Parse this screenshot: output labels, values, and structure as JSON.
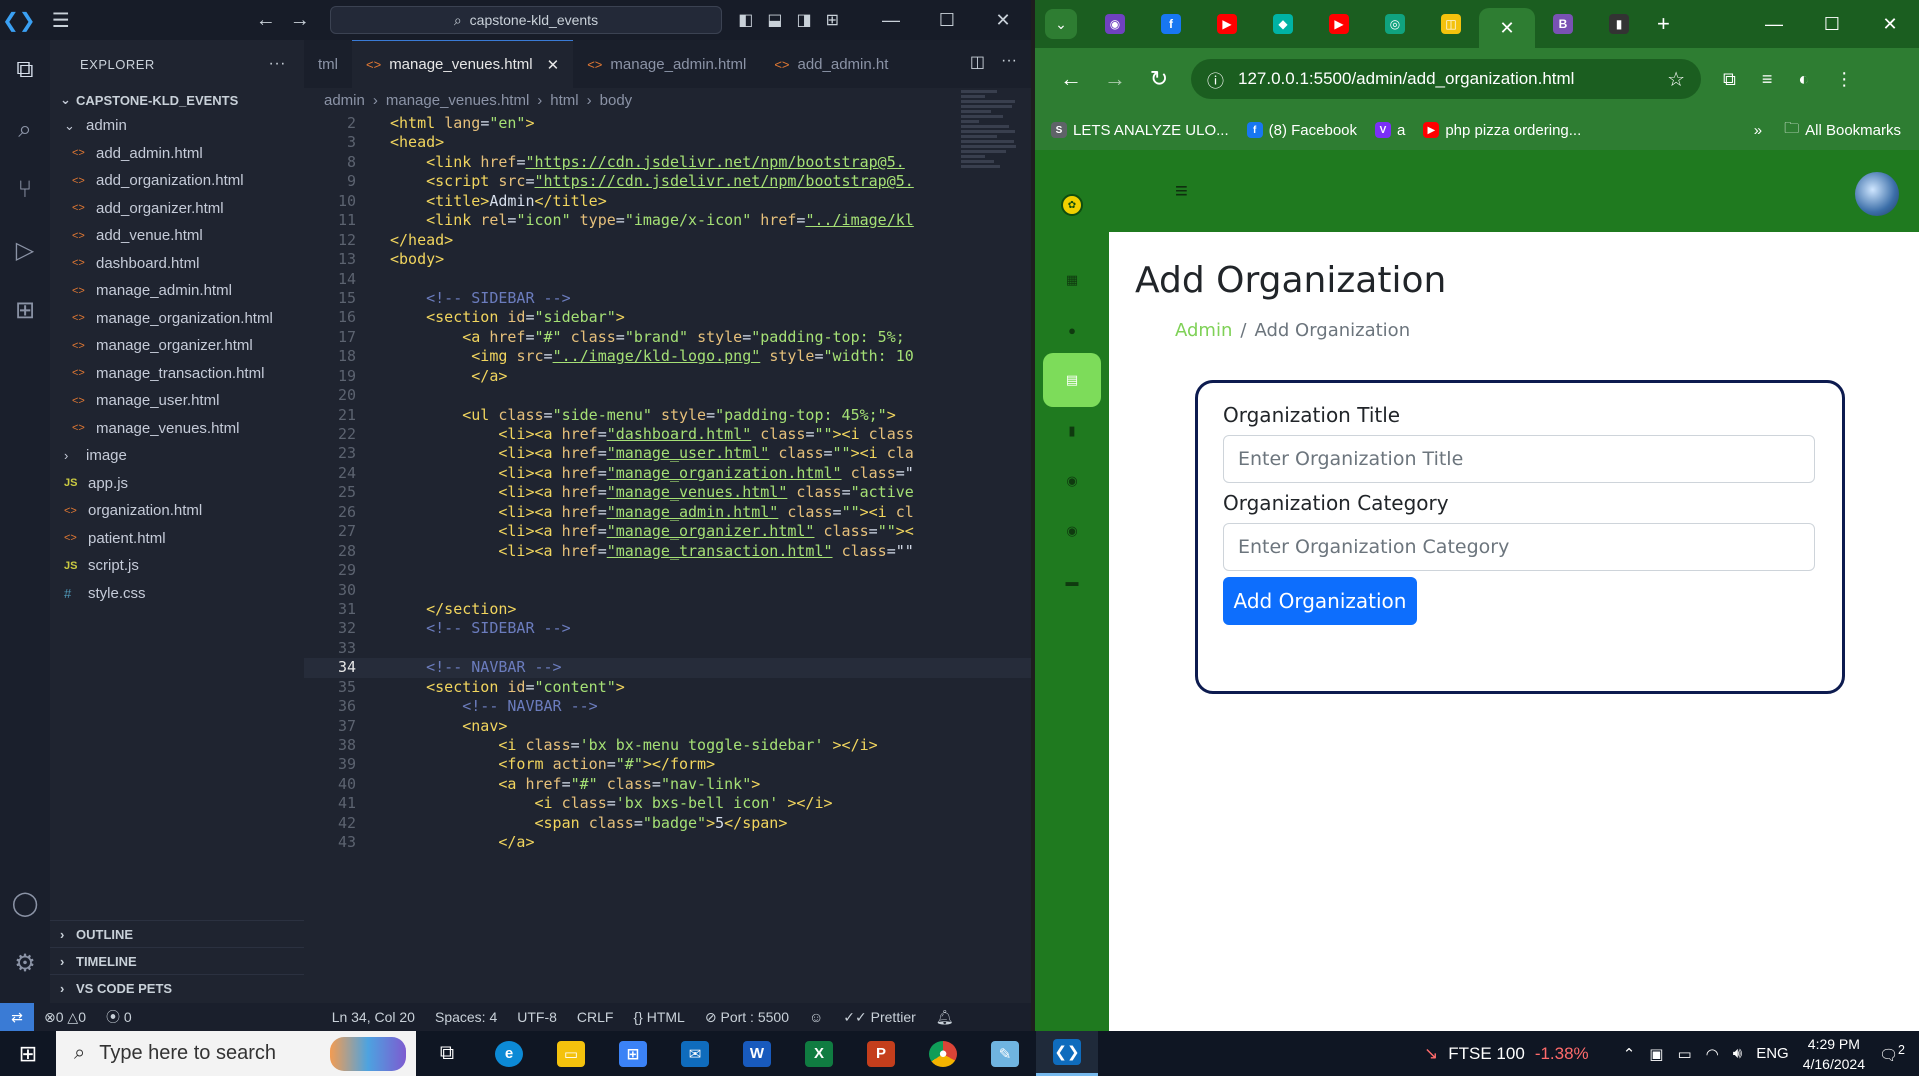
{
  "vscode": {
    "search_text": "capstone-kld_events",
    "explorer_title": "EXPLORER",
    "root_folder": "CAPSTONE-KLD_EVENTS",
    "tree": [
      {
        "label": "admin",
        "type": "folder-open",
        "depth": 1
      },
      {
        "label": "add_admin.html",
        "type": "html",
        "depth": 2
      },
      {
        "label": "add_organization.html",
        "type": "html",
        "depth": 2
      },
      {
        "label": "add_organizer.html",
        "type": "html",
        "depth": 2
      },
      {
        "label": "add_venue.html",
        "type": "html",
        "depth": 2
      },
      {
        "label": "dashboard.html",
        "type": "html",
        "depth": 2
      },
      {
        "label": "manage_admin.html",
        "type": "html",
        "depth": 2
      },
      {
        "label": "manage_organization.html",
        "type": "html",
        "depth": 2
      },
      {
        "label": "manage_organizer.html",
        "type": "html",
        "depth": 2
      },
      {
        "label": "manage_transaction.html",
        "type": "html",
        "depth": 2
      },
      {
        "label": "manage_user.html",
        "type": "html",
        "depth": 2
      },
      {
        "label": "manage_venues.html",
        "type": "html",
        "depth": 2
      },
      {
        "label": "image",
        "type": "folder",
        "depth": 1
      },
      {
        "label": "app.js",
        "type": "js",
        "depth": 1
      },
      {
        "label": "organization.html",
        "type": "html",
        "depth": 1
      },
      {
        "label": "patient.html",
        "type": "html",
        "depth": 1
      },
      {
        "label": "script.js",
        "type": "js",
        "depth": 1
      },
      {
        "label": "style.css",
        "type": "css",
        "depth": 1
      }
    ],
    "sections": [
      "OUTLINE",
      "TIMELINE",
      "VS CODE PETS"
    ],
    "tabs": [
      {
        "label": "tml",
        "active": false
      },
      {
        "label": "manage_venues.html",
        "active": true
      },
      {
        "label": "manage_admin.html",
        "active": false
      },
      {
        "label": "add_admin.ht",
        "active": false
      }
    ],
    "breadcrumb": [
      "admin",
      "manage_venues.html",
      "html",
      "body"
    ],
    "code_lines": [
      {
        "n": "2",
        "tokens": [
          [
            "tag",
            "<html "
          ],
          [
            "attr",
            "lang"
          ],
          [
            "pl",
            "="
          ],
          [
            "strp",
            "\"en\""
          ],
          [
            "tag",
            ">"
          ]
        ]
      },
      {
        "n": "3",
        "tokens": [
          [
            "tag",
            "<head>"
          ]
        ]
      },
      {
        "n": "8",
        "tokens": [
          [
            "pl",
            "    "
          ],
          [
            "tag",
            "<link "
          ],
          [
            "attr",
            "href"
          ],
          [
            "pl",
            "="
          ],
          [
            "str",
            "\"https://cdn.jsdelivr.net/npm/bootstrap@5."
          ]
        ]
      },
      {
        "n": "9",
        "tokens": [
          [
            "pl",
            "    "
          ],
          [
            "tag",
            "<script "
          ],
          [
            "attr",
            "src"
          ],
          [
            "pl",
            "="
          ],
          [
            "str",
            "\"https://cdn.jsdelivr.net/npm/bootstrap@5."
          ]
        ]
      },
      {
        "n": "10",
        "tokens": [
          [
            "pl",
            "    "
          ],
          [
            "tag",
            "<title>"
          ],
          [
            "pl",
            "Admin"
          ],
          [
            "tag",
            "</title>"
          ]
        ]
      },
      {
        "n": "11",
        "tokens": [
          [
            "pl",
            "    "
          ],
          [
            "tag",
            "<link "
          ],
          [
            "attr",
            "rel"
          ],
          [
            "pl",
            "="
          ],
          [
            "strp",
            "\"icon\" "
          ],
          [
            "attr",
            "type"
          ],
          [
            "pl",
            "="
          ],
          [
            "strp",
            "\"image/x-icon\" "
          ],
          [
            "attr",
            "href"
          ],
          [
            "pl",
            "="
          ],
          [
            "str",
            "\"../image/kl"
          ]
        ]
      },
      {
        "n": "12",
        "tokens": [
          [
            "tag",
            "</head>"
          ]
        ]
      },
      {
        "n": "13",
        "tokens": [
          [
            "tag",
            "<body>"
          ]
        ]
      },
      {
        "n": "14",
        "tokens": []
      },
      {
        "n": "15",
        "tokens": [
          [
            "pl",
            "    "
          ],
          [
            "cm",
            "<!-- SIDEBAR -->"
          ]
        ]
      },
      {
        "n": "16",
        "tokens": [
          [
            "pl",
            "    "
          ],
          [
            "tag",
            "<section "
          ],
          [
            "attr",
            "id"
          ],
          [
            "pl",
            "="
          ],
          [
            "strp",
            "\"sidebar\""
          ],
          [
            "tag",
            ">"
          ]
        ]
      },
      {
        "n": "17",
        "tokens": [
          [
            "pl",
            "        "
          ],
          [
            "tag",
            "<a "
          ],
          [
            "attr",
            "href"
          ],
          [
            "pl",
            "="
          ],
          [
            "strp",
            "\"#\" "
          ],
          [
            "attr",
            "class"
          ],
          [
            "pl",
            "="
          ],
          [
            "strp",
            "\"brand\" "
          ],
          [
            "attr",
            "style"
          ],
          [
            "pl",
            "="
          ],
          [
            "strp",
            "\"padding-top: 5%;"
          ]
        ]
      },
      {
        "n": "18",
        "tokens": [
          [
            "pl",
            "         "
          ],
          [
            "tag",
            "<img "
          ],
          [
            "attr",
            "src"
          ],
          [
            "pl",
            "="
          ],
          [
            "str",
            "\"../image/kld-logo.png\""
          ],
          [
            "pl",
            " "
          ],
          [
            "attr",
            "style"
          ],
          [
            "pl",
            "="
          ],
          [
            "strp",
            "\"width: 10"
          ]
        ]
      },
      {
        "n": "19",
        "tokens": [
          [
            "pl",
            "         "
          ],
          [
            "tag",
            "</a>"
          ]
        ]
      },
      {
        "n": "20",
        "tokens": []
      },
      {
        "n": "21",
        "tokens": [
          [
            "pl",
            "        "
          ],
          [
            "tag",
            "<ul "
          ],
          [
            "attr",
            "class"
          ],
          [
            "pl",
            "="
          ],
          [
            "strp",
            "\"side-menu\" "
          ],
          [
            "attr",
            "style"
          ],
          [
            "pl",
            "="
          ],
          [
            "strp",
            "\"padding-top: 45%;\""
          ],
          [
            "tag",
            ">"
          ]
        ]
      },
      {
        "n": "22",
        "tokens": [
          [
            "pl",
            "            "
          ],
          [
            "tag",
            "<li><a "
          ],
          [
            "attr",
            "href"
          ],
          [
            "pl",
            "="
          ],
          [
            "str",
            "\"dashboard.html\""
          ],
          [
            "pl",
            " "
          ],
          [
            "attr",
            "class"
          ],
          [
            "pl",
            "="
          ],
          [
            "strp",
            "\"\""
          ],
          [
            "tag",
            "><i "
          ],
          [
            "attr",
            "class"
          ]
        ]
      },
      {
        "n": "23",
        "tokens": [
          [
            "pl",
            "            "
          ],
          [
            "tag",
            "<li><a "
          ],
          [
            "attr",
            "href"
          ],
          [
            "pl",
            "="
          ],
          [
            "str",
            "\"manage_user.html\""
          ],
          [
            "pl",
            " "
          ],
          [
            "attr",
            "class"
          ],
          [
            "pl",
            "="
          ],
          [
            "strp",
            "\"\""
          ],
          [
            "tag",
            "><i "
          ],
          [
            "attr",
            "cla"
          ]
        ]
      },
      {
        "n": "24",
        "tokens": [
          [
            "pl",
            "            "
          ],
          [
            "tag",
            "<li><a "
          ],
          [
            "attr",
            "href"
          ],
          [
            "pl",
            "="
          ],
          [
            "str",
            "\"manage_organization.html\""
          ],
          [
            "pl",
            " "
          ],
          [
            "attr",
            "class"
          ],
          [
            "pl",
            "=\""
          ]
        ]
      },
      {
        "n": "25",
        "tokens": [
          [
            "pl",
            "            "
          ],
          [
            "tag",
            "<li><a "
          ],
          [
            "attr",
            "href"
          ],
          [
            "pl",
            "="
          ],
          [
            "str",
            "\"manage_venues.html\""
          ],
          [
            "pl",
            " "
          ],
          [
            "attr",
            "class"
          ],
          [
            "pl",
            "="
          ],
          [
            "strp",
            "\"active"
          ]
        ]
      },
      {
        "n": "26",
        "tokens": [
          [
            "pl",
            "            "
          ],
          [
            "tag",
            "<li><a "
          ],
          [
            "attr",
            "href"
          ],
          [
            "pl",
            "="
          ],
          [
            "str",
            "\"manage_admin.html\""
          ],
          [
            "pl",
            " "
          ],
          [
            "attr",
            "class"
          ],
          [
            "pl",
            "="
          ],
          [
            "strp",
            "\"\""
          ],
          [
            "tag",
            "><i "
          ],
          [
            "attr",
            "cl"
          ]
        ]
      },
      {
        "n": "27",
        "tokens": [
          [
            "pl",
            "            "
          ],
          [
            "tag",
            "<li><a "
          ],
          [
            "attr",
            "href"
          ],
          [
            "pl",
            "="
          ],
          [
            "str",
            "\"manage_organizer.html\""
          ],
          [
            "pl",
            " "
          ],
          [
            "attr",
            "class"
          ],
          [
            "pl",
            "="
          ],
          [
            "strp",
            "\"\""
          ],
          [
            "tag",
            ">&lt;"
          ]
        ]
      },
      {
        "n": "28",
        "tokens": [
          [
            "pl",
            "            "
          ],
          [
            "tag",
            "<li><a "
          ],
          [
            "attr",
            "href"
          ],
          [
            "pl",
            "="
          ],
          [
            "str",
            "\"manage_transaction.html\""
          ],
          [
            "pl",
            " "
          ],
          [
            "attr",
            "class"
          ],
          [
            "pl",
            "=\"\""
          ]
        ]
      },
      {
        "n": "29",
        "tokens": []
      },
      {
        "n": "30",
        "tokens": []
      },
      {
        "n": "31",
        "tokens": [
          [
            "pl",
            "    "
          ],
          [
            "tag",
            "</section>"
          ]
        ]
      },
      {
        "n": "32",
        "tokens": [
          [
            "pl",
            "    "
          ],
          [
            "cm",
            "<!-- SIDEBAR -->"
          ]
        ]
      },
      {
        "n": "33",
        "tokens": []
      },
      {
        "n": "34",
        "tokens": [
          [
            "pl",
            "    "
          ],
          [
            "cm",
            "<!-- NAVBAR -->"
          ]
        ],
        "current": true
      },
      {
        "n": "35",
        "tokens": [
          [
            "pl",
            "    "
          ],
          [
            "tag",
            "<section "
          ],
          [
            "attr",
            "id"
          ],
          [
            "pl",
            "="
          ],
          [
            "strp",
            "\"content\""
          ],
          [
            "tag",
            ">"
          ]
        ]
      },
      {
        "n": "36",
        "tokens": [
          [
            "pl",
            "        "
          ],
          [
            "cm",
            "<!-- NAVBAR -->"
          ]
        ]
      },
      {
        "n": "37",
        "tokens": [
          [
            "pl",
            "        "
          ],
          [
            "tag",
            "<nav>"
          ]
        ]
      },
      {
        "n": "38",
        "tokens": [
          [
            "pl",
            "            "
          ],
          [
            "tag",
            "<i "
          ],
          [
            "attr",
            "class"
          ],
          [
            "pl",
            "="
          ],
          [
            "strp",
            "'bx bx-menu toggle-sidebar' "
          ],
          [
            "tag",
            "></i>"
          ]
        ]
      },
      {
        "n": "39",
        "tokens": [
          [
            "pl",
            "            "
          ],
          [
            "tag",
            "<form "
          ],
          [
            "attr",
            "action"
          ],
          [
            "pl",
            "="
          ],
          [
            "strp",
            "\"#\""
          ],
          [
            "tag",
            "></form>"
          ]
        ]
      },
      {
        "n": "40",
        "tokens": [
          [
            "pl",
            "            "
          ],
          [
            "tag",
            "<a "
          ],
          [
            "attr",
            "href"
          ],
          [
            "pl",
            "="
          ],
          [
            "strp",
            "\"#\" "
          ],
          [
            "attr",
            "class"
          ],
          [
            "pl",
            "="
          ],
          [
            "strp",
            "\"nav-link\""
          ],
          [
            "tag",
            ">"
          ]
        ]
      },
      {
        "n": "41",
        "tokens": [
          [
            "pl",
            "                "
          ],
          [
            "tag",
            "<i "
          ],
          [
            "attr",
            "class"
          ],
          [
            "pl",
            "="
          ],
          [
            "strp",
            "'bx bxs-bell icon' "
          ],
          [
            "tag",
            "></i>"
          ]
        ]
      },
      {
        "n": "42",
        "tokens": [
          [
            "pl",
            "                "
          ],
          [
            "tag",
            "<span "
          ],
          [
            "attr",
            "class"
          ],
          [
            "pl",
            "="
          ],
          [
            "strp",
            "\"badge\""
          ],
          [
            "tag",
            ">"
          ],
          [
            "pl",
            "5"
          ],
          [
            "tag",
            "</span>"
          ]
        ]
      },
      {
        "n": "43",
        "tokens": [
          [
            "pl",
            "            "
          ],
          [
            "tag",
            "</a>"
          ]
        ]
      }
    ],
    "status": {
      "errors": "0",
      "warnings": "0",
      "ports": "0",
      "position": "Ln 34, Col 20",
      "spaces": "Spaces: 4",
      "encoding": "UTF-8",
      "eol": "CRLF",
      "language": "HTML",
      "port": "Port : 5500",
      "formatter": "Prettier"
    }
  },
  "chrome": {
    "url": "127.0.0.1:5500/admin/add_organization.html",
    "bookmarks": [
      {
        "label": "LETS ANALYZE ULO...",
        "color": "#5f6368",
        "glyph": "S"
      },
      {
        "label": "(8) Facebook",
        "color": "#1877f2",
        "glyph": "f"
      },
      {
        "label": "a",
        "color": "#7b2ff7",
        "glyph": "V"
      },
      {
        "label": "php pizza ordering...",
        "color": "#ff0000",
        "glyph": "▶"
      }
    ],
    "all_bookmarks": "All Bookmarks",
    "tab_favicons": [
      {
        "color": "#6f42c1",
        "glyph": "◉"
      },
      {
        "color": "#1877f2",
        "glyph": "f"
      },
      {
        "color": "#ff0000",
        "glyph": "▶"
      },
      {
        "color": "#00b3a4",
        "glyph": "◆"
      },
      {
        "color": "#ff0000",
        "glyph": "▶"
      },
      {
        "color": "#10a37f",
        "glyph": "◎"
      },
      {
        "color": "#f4c20d",
        "glyph": "◫"
      },
      {
        "color": "active",
        "glyph": "✕"
      },
      {
        "color": "#7952b3",
        "glyph": "B"
      },
      {
        "color": "#333333",
        "glyph": "▮"
      }
    ]
  },
  "page": {
    "title": "Add Organization",
    "breadcrumb_link": "Admin",
    "breadcrumb_sep": "/",
    "breadcrumb_current": "Add Organization",
    "fields": [
      {
        "label": "Organization Title",
        "placeholder": "Enter Organization Title",
        "value": ""
      },
      {
        "label": "Organization Category",
        "placeholder": "Enter Organization Category",
        "value": ""
      }
    ],
    "submit_label": "Add Organization",
    "sidebar_icons": [
      "dashboard-icon",
      "user-icon",
      "organization-icon",
      "building-icon",
      "user-circle-icon",
      "user-circle-icon",
      "wallet-icon"
    ],
    "sidebar_active_index": 2
  },
  "taskbar": {
    "search_placeholder": "Type here to search",
    "ticker_name": "FTSE 100",
    "ticker_change": "-1.38%",
    "language": "ENG",
    "time": "4:29 PM",
    "date": "4/16/2024",
    "notifications": "2"
  }
}
